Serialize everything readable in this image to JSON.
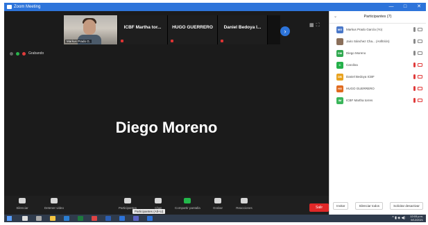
{
  "window": {
    "title": "Zoom Meeting"
  },
  "thumbnails": [
    {
      "type": "camera",
      "name": "Markus Prado G."
    },
    {
      "type": "name",
      "label": "ICBF Martha tor..."
    },
    {
      "type": "name",
      "label": "HUGO GUERRERO"
    },
    {
      "type": "name",
      "label": "Daniel Bedoya I..."
    }
  ],
  "status": {
    "recording_label": "Grabando"
  },
  "speaker": {
    "name": "Diego Moreno"
  },
  "toolbar": {
    "mute": "Silenciar",
    "stop_video": "Detener video",
    "participants": "Participantes",
    "participants_count": "7",
    "chat": "Chat",
    "share_screen": "Compartir pantalla",
    "record": "Grabar",
    "reactions": "Reacciones",
    "tooltip": "Participantes (Alt+U)",
    "leave": "Salir"
  },
  "panel": {
    "title": "Participantes (7)",
    "participants": [
      {
        "initials": "MG",
        "color": "#4a78c9",
        "name": "Markus Prado García (Yo)",
        "mic": "on",
        "cam": "on"
      },
      {
        "initials": "",
        "color": "#8a6f5a",
        "name": "Jairo Sánchez Cha... (Anfitrión)",
        "mic": "on",
        "cam": "on"
      },
      {
        "initials": "DM",
        "color": "#2fa84f",
        "name": "Diego Moreno",
        "mic": "on",
        "cam": "on"
      },
      {
        "initials": "C",
        "color": "#24b04a",
        "name": "Carolina",
        "mic": "off",
        "cam": "off"
      },
      {
        "initials": "DB",
        "color": "#e8a21f",
        "name": "Daniel Bedoya ICBF",
        "mic": "off",
        "cam": "off"
      },
      {
        "initials": "HG",
        "color": "#e06a1f",
        "name": "HUGO GUERRERO",
        "mic": "off",
        "cam": "off"
      },
      {
        "initials": "IM",
        "color": "#3ab55a",
        "name": "ICBF Martha torres",
        "mic": "off",
        "cam": "off"
      }
    ],
    "footer": {
      "invite": "Invitar",
      "mute_all": "Silenciar todos",
      "more": "Solicitar desactivar"
    }
  },
  "taskbar": {
    "time": "12:03 p.m.",
    "date": "9/12/2021"
  }
}
